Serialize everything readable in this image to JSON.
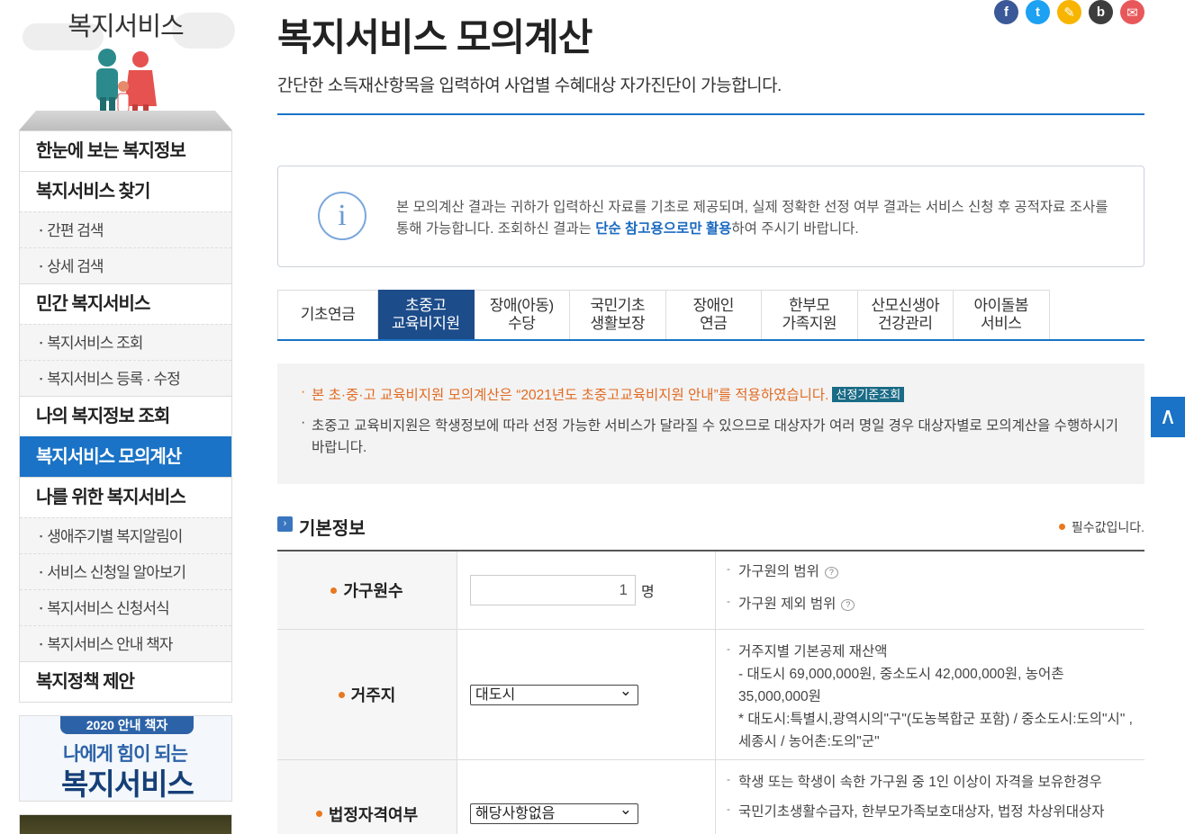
{
  "sidebar": {
    "title": "복지서비스",
    "menu": [
      {
        "label": "한눈에 보는 복지정보",
        "level": 1
      },
      {
        "label": "복지서비스 찾기",
        "level": 1
      },
      {
        "label": "간편 검색",
        "level": 2
      },
      {
        "label": "상세 검색",
        "level": 2
      },
      {
        "label": "민간 복지서비스",
        "level": 1
      },
      {
        "label": "복지서비스 조회",
        "level": 2
      },
      {
        "label": "복지서비스 등록 · 수정",
        "level": 2
      },
      {
        "label": "나의 복지정보 조회",
        "level": 1
      },
      {
        "label": "복지서비스 모의계산",
        "level": 1,
        "active": true
      },
      {
        "label": "나를 위한 복지서비스",
        "level": 1
      },
      {
        "label": "생애주기별 복지알림이",
        "level": 2
      },
      {
        "label": "서비스 신청일 알아보기",
        "level": 2
      },
      {
        "label": "복지서비스 신청서식",
        "level": 2
      },
      {
        "label": "복지서비스 안내 책자",
        "level": 2
      },
      {
        "label": "복지정책 제안",
        "level": 1
      }
    ],
    "banner": {
      "tag": "2020 안내 책자",
      "line1": "나에게 힘이 되는",
      "line2": "복지서비스"
    }
  },
  "header": {
    "title": "복지서비스 모의계산",
    "subtitle": "간단한 소득재산항목을 입력하여 사업별 수혜대상 자가진단이 가능합니다.",
    "sns": [
      {
        "icon": "facebook-icon",
        "glyph": "f",
        "color": "#3b5998"
      },
      {
        "icon": "twitter-icon",
        "glyph": "t",
        "color": "#1da1f2"
      },
      {
        "icon": "kakaostory-icon",
        "glyph": "✎",
        "color": "#f7b500"
      },
      {
        "icon": "band-icon",
        "glyph": "b",
        "color": "#3d3d3d"
      },
      {
        "icon": "mail-icon",
        "glyph": "✉",
        "color": "#e8585a"
      }
    ]
  },
  "notice": {
    "text_before": "본 모의계산 결과는 귀하가 입력하신 자료를 기초로 제공되며, 실제 정확한 선정 여부 결과는 서비스 신청 후 공적자료 조사를 통해 가능합니다. 조회하신 결과는 ",
    "highlight": "단순 참고용으로만 활용",
    "text_after": "하여 주시기 바랍니다."
  },
  "tabs": [
    {
      "label": "기초연금"
    },
    {
      "label": "초중고\n교육비지원",
      "active": true
    },
    {
      "label": "장애(아동)\n수당"
    },
    {
      "label": "국민기초\n생활보장"
    },
    {
      "label": "장애인\n연금"
    },
    {
      "label": "한부모\n가족지원"
    },
    {
      "label": "산모신생아\n건강관리"
    },
    {
      "label": "아이돌봄\n서비스"
    }
  ],
  "guide": {
    "item1": "본 초·중·고 교육비지원 모의계산은 “2021년도 초중고교육비지원 안내”를 적용하였습니다.",
    "badge": "선정기준조회",
    "item2": "초중고 교육비지원은 학생정보에 따라 선정 가능한 서비스가 달라질 수 있으므로 대상자가 여러 명일 경우 대상자별로 모의계산을 수행하시기 바랍니다."
  },
  "section": {
    "title": "기본정보",
    "required_note": "필수값입니다."
  },
  "form": {
    "household": {
      "label": "가구원수",
      "value": "1",
      "unit": "명",
      "help1": "가구원의 범위",
      "help2": "가구원 제외 범위"
    },
    "residence": {
      "label": "거주지",
      "selected": "대도시",
      "help_title": "거주지별 기본공제 재산액",
      "help_line1": "- 대도시 69,000,000원, 중소도시 42,000,000원, 농어촌 35,000,000원",
      "help_line2": "* 대도시:특별시,광역시의\"구\"(도농복합군 포함) / 중소도시:도의\"시\" ,세종시 / 농어촌:도의\"군\""
    },
    "qualification": {
      "label": "법정자격여부",
      "selected": "해당사항없음",
      "help1": "학생 또는 학생이 속한 가구원 중 1인 이상이 자격을 보유한경우",
      "help2": "국민기초생활수급자, 한부모가족보호대상자, 법정 차상위대상자"
    }
  },
  "top_button": "∧"
}
